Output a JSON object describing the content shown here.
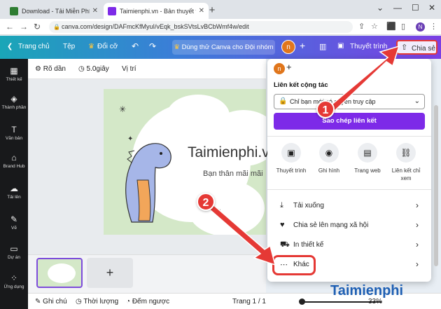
{
  "browser": {
    "tabs": [
      {
        "title": "Download - Tải Miễn Phí VN - P",
        "active": false
      },
      {
        "title": "Taimienphi.vn - Bản thuyết trình",
        "active": true
      }
    ],
    "url": "canva.com/design/DAFmcKfMyuI/vEqk_bskSVtsLvBCbWmf4w/edit",
    "profile_initial": "N"
  },
  "canva_header": {
    "home": "Trang chủ",
    "file": "Tệp",
    "resize": "Đổi cỡ",
    "try_team": "Dùng thử Canva cho Đội nhóm",
    "present": "Thuyết trình",
    "share": "Chia sẻ",
    "avatar_initial": "n"
  },
  "sidebar": {
    "items": [
      {
        "label": "Thiết kế",
        "icon": "layout-icon"
      },
      {
        "label": "Thành phần",
        "icon": "elements-icon"
      },
      {
        "label": "Văn bản",
        "icon": "text-icon"
      },
      {
        "label": "Brand Hub",
        "icon": "brand-icon"
      },
      {
        "label": "Tải lên",
        "icon": "upload-icon"
      },
      {
        "label": "Vẽ",
        "icon": "draw-icon"
      },
      {
        "label": "Dự án",
        "icon": "folder-icon"
      },
      {
        "label": "Ứng dụng",
        "icon": "apps-icon"
      }
    ]
  },
  "toolbar": {
    "animate": "Rõ dần",
    "duration": "5.0giây",
    "position": "Vị trí"
  },
  "slide": {
    "title": "Taimienphi.vn",
    "subtitle": "Bạn thân mãi mãi"
  },
  "statusbar": {
    "notes": "Ghi chú",
    "timer": "Thời lượng",
    "countdown": "Đếm ngược",
    "page": "Trang 1 / 1",
    "zoom": "33%",
    "zoom_level": 0.33
  },
  "share_panel": {
    "avatar_initial": "n",
    "collab_title": "Liên kết cộng tác",
    "access_select": "Chỉ bạn mới có quyền truy cập",
    "copy_link": "Sao chép liên kết",
    "options": [
      {
        "label": "Thuyết trình",
        "icon": "present-icon"
      },
      {
        "label": "Ghi hình",
        "icon": "record-icon"
      },
      {
        "label": "Trang web",
        "icon": "website-icon"
      },
      {
        "label": "Liên kết chỉ xem",
        "icon": "link-icon"
      }
    ],
    "rows": [
      {
        "label": "Tải xuống",
        "icon": "download-icon"
      },
      {
        "label": "Chia sẻ lên mạng xã hội",
        "icon": "heart-icon"
      },
      {
        "label": "In thiết kế",
        "icon": "truck-icon"
      },
      {
        "label": "Khác",
        "icon": "more-icon"
      }
    ]
  },
  "annotations": {
    "step1": "1",
    "step2": "2",
    "highlight_color": "#e53935"
  },
  "watermark": "Taimienphi"
}
